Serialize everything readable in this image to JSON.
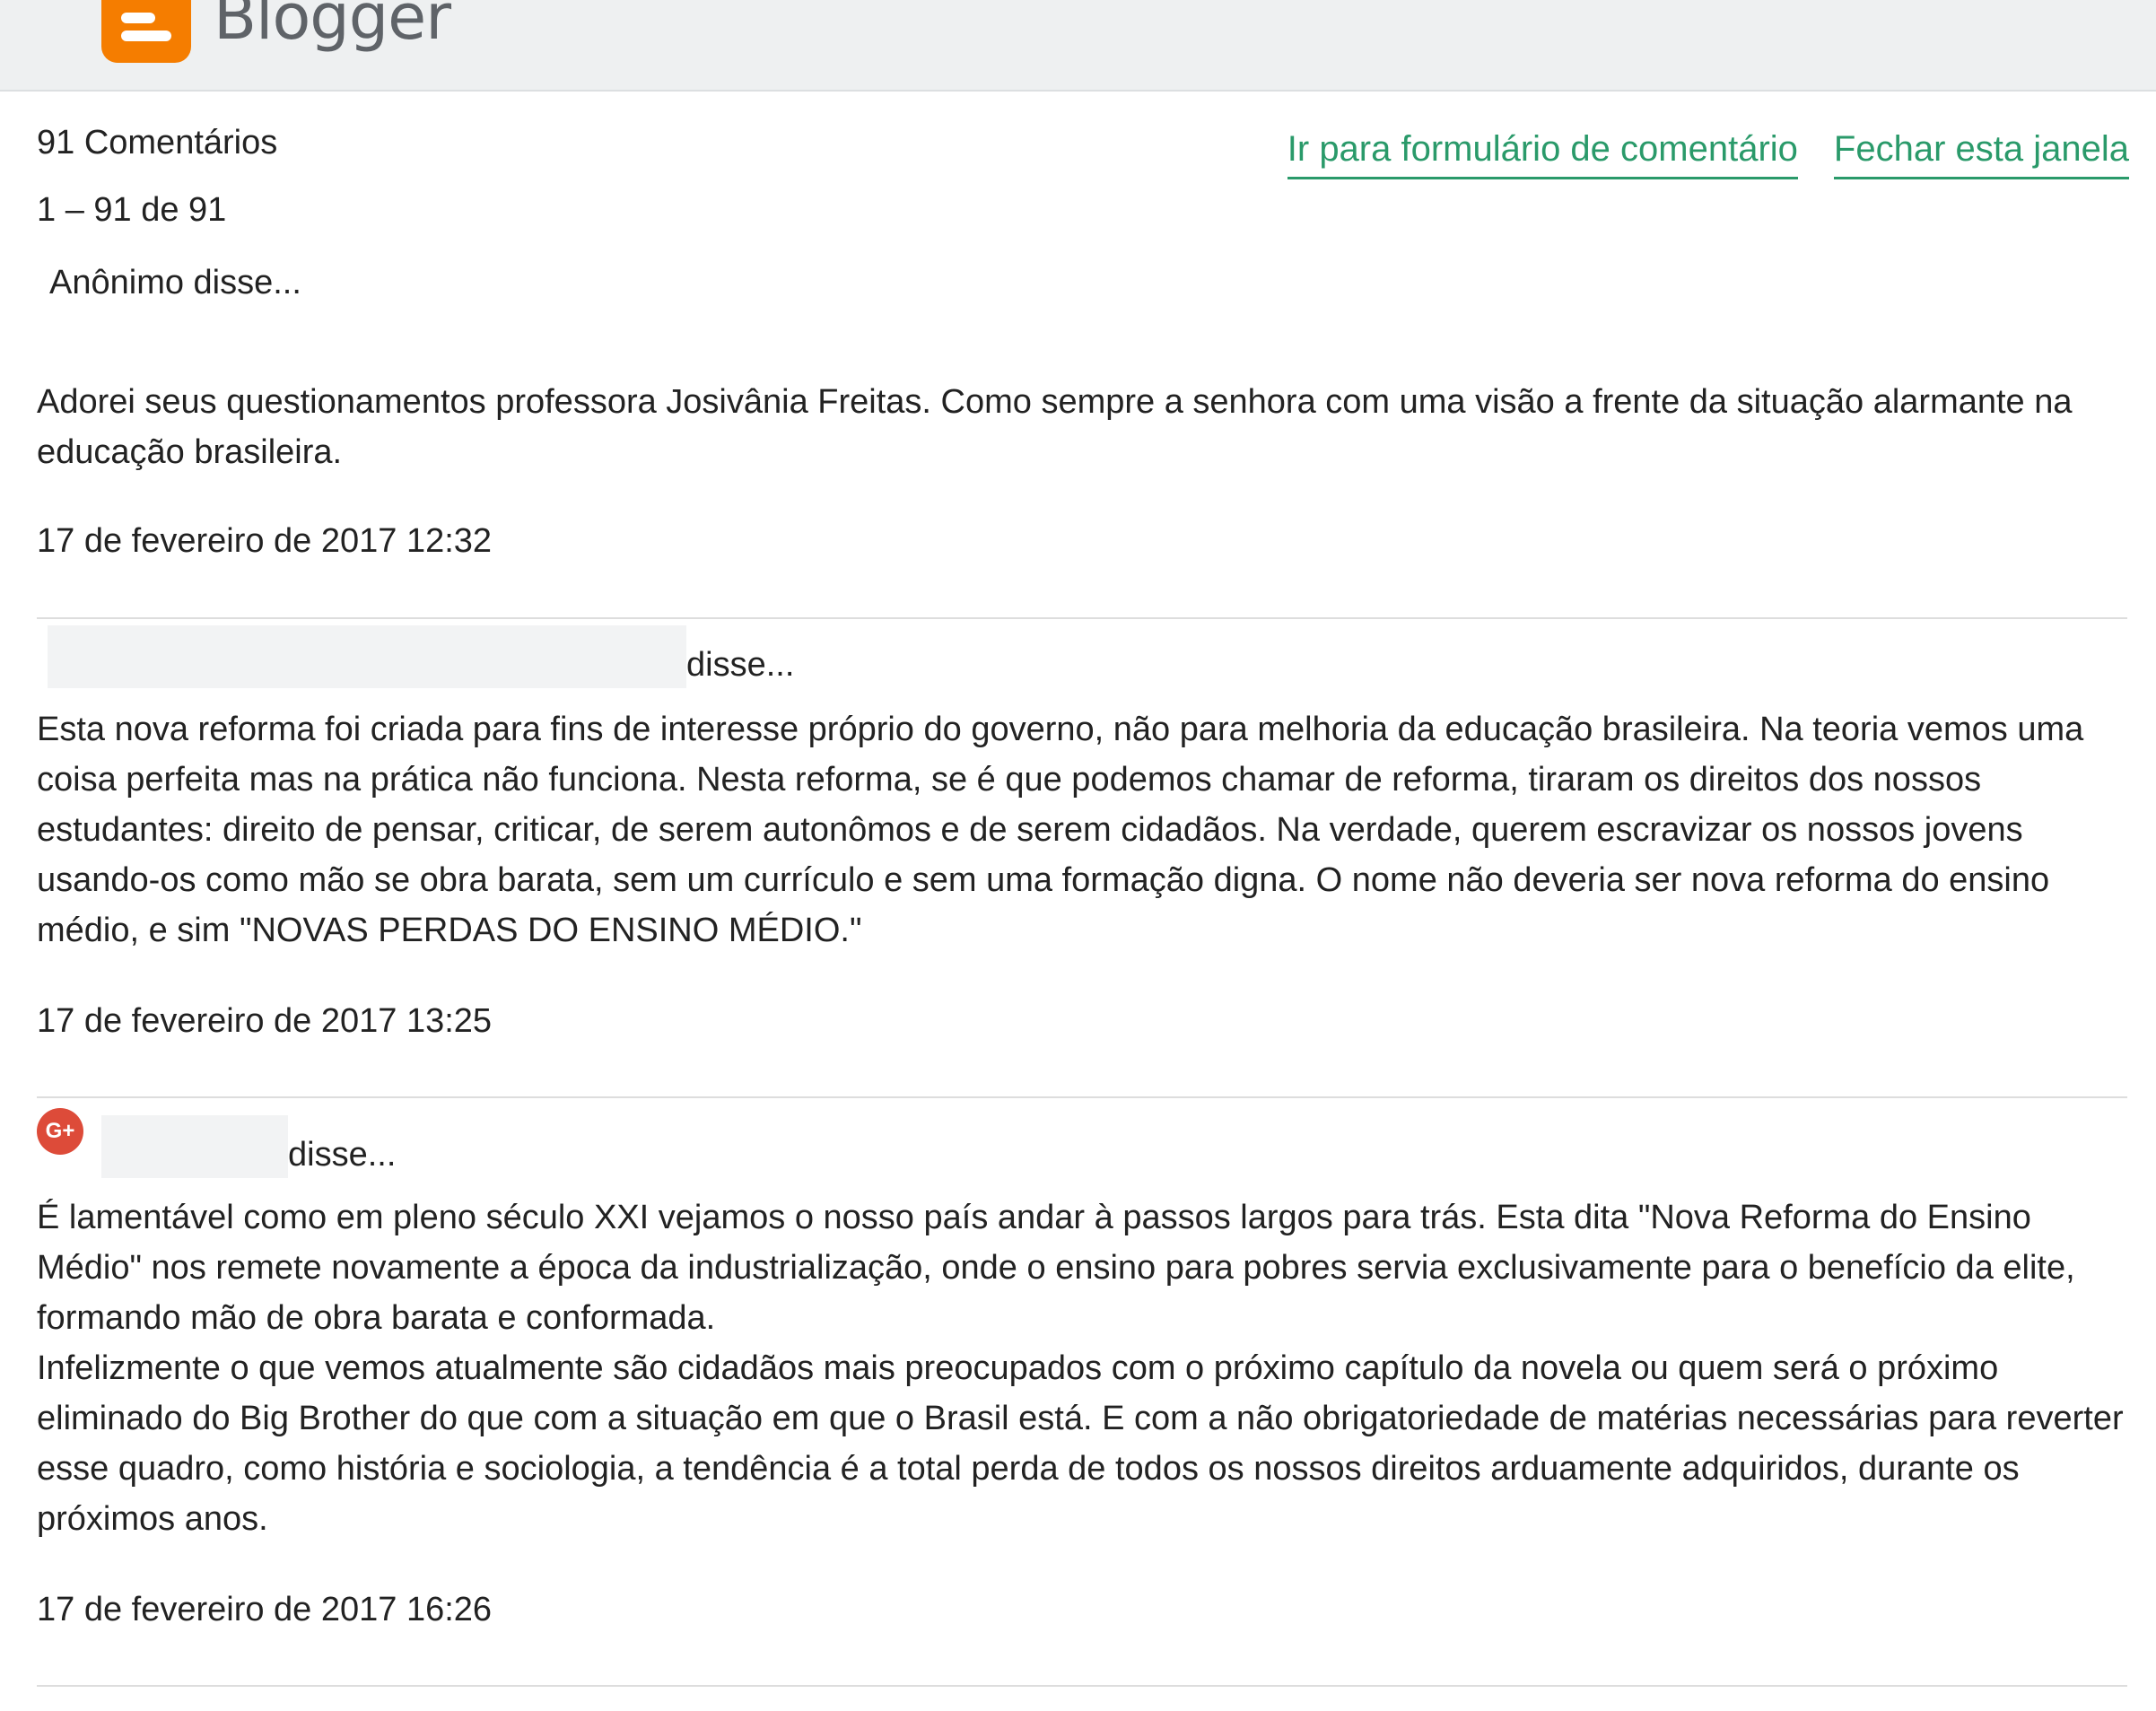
{
  "header": {
    "brand": "Blogger",
    "logo_icon": "blogger-logo-icon",
    "accent_color": "#f57d00"
  },
  "summary": {
    "count_label": "91 Comentários",
    "range_label": "1 – 91 de 91"
  },
  "links": {
    "goto_form": "Ir para formulário de comentário",
    "close_window": "Fechar esta janela",
    "link_color": "#2a9a6a"
  },
  "comments": [
    {
      "author": "Anônimo disse...",
      "text": "Adorei seus questionamentos professora Josivânia Freitas. Como sempre a senhora com uma visão a frente da situação alarmante na educação brasileira.",
      "timestamp": "17 de fevereiro de 2017 12:32"
    },
    {
      "says": "disse...",
      "text": "Esta nova reforma foi criada para fins de interesse próprio do governo, não para melhoria da educação brasileira. Na teoria vemos uma coisa perfeita mas na prática não funciona. Nesta reforma, se é que podemos chamar de reforma, tiraram os direitos dos nossos estudantes: direito de pensar, criticar, de serem autonômos e de serem cidadãos. Na verdade, querem escravizar os nossos jovens usando-os como mão se obra barata, sem um currículo e sem uma formação digna. O nome não deveria ser nova reforma do ensino médio, e sim \"NOVAS PERDAS DO ENSINO MÉDIO.\"",
      "timestamp": "17 de fevereiro de 2017 13:25"
    },
    {
      "says": "disse...",
      "avatar_icon": "google-plus-icon",
      "avatar_glyph": "G+",
      "text_p1": "É lamentável como em pleno século XXI vejamos o nosso país andar à passos largos para trás. Esta dita \"Nova Reforma do Ensino Médio\" nos remete novamente a época da industrialização, onde o ensino para pobres servia exclusivamente para o benefício da elite, formando mão de obra barata e conformada.",
      "text_p2": "Infelizmente o que vemos atualmente são cidadãos mais preocupados com o próximo capítulo da novela ou quem será o próximo eliminado do Big Brother do que com a situação em que o Brasil está. E com a não obrigatoriedade de matérias necessárias para reverter esse quadro, como história e sociologia, a tendência é a total perda de todos os nossos direitos arduamente adquiridos, durante os próximos anos.",
      "timestamp": "17 de fevereiro de 2017 16:26"
    }
  ]
}
